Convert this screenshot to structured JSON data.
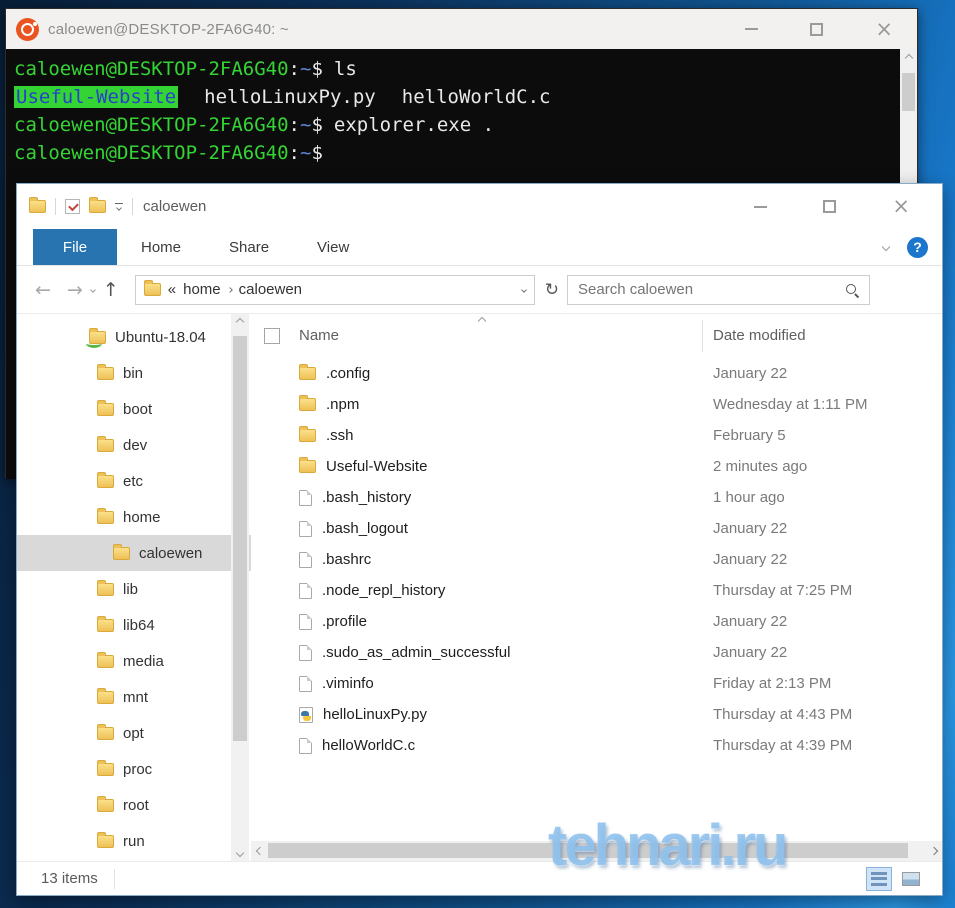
{
  "desktop": {
    "watermark": "tehnari.ru"
  },
  "terminal": {
    "title": "caloewen@DESKTOP-2FA6G40: ~",
    "user_host": "caloewen@DESKTOP-2FA6G40",
    "separator": ":",
    "path": "~",
    "prompt_symbol": "$",
    "command_ls": "ls",
    "ls_output": {
      "highlighted_dir": "Useful-Website",
      "file1": "helloLinuxPy.py",
      "file2": "helloWorldC.c"
    },
    "command_explorer": "explorer.exe .",
    "colors": {
      "prompt_green": "#35d435",
      "path_blue": "#5f87d7",
      "dir_text_blue": "#2742c9",
      "background": "#0c0c0c"
    }
  },
  "explorer": {
    "title": "caloewen",
    "tabs": {
      "file": "File",
      "home": "Home",
      "share": "Share",
      "view": "View"
    },
    "address": {
      "prefix": "«",
      "crumb1": "home",
      "crumb2": "caloewen"
    },
    "search": {
      "placeholder": "Search caloewen"
    },
    "columns": {
      "name": "Name",
      "date_modified": "Date modified"
    },
    "tree": [
      {
        "label": "Ubuntu-18.04",
        "level": 0,
        "icon": "ubuntu-folder",
        "selected": false
      },
      {
        "label": "bin",
        "level": 1,
        "icon": "folder",
        "selected": false
      },
      {
        "label": "boot",
        "level": 1,
        "icon": "folder",
        "selected": false
      },
      {
        "label": "dev",
        "level": 1,
        "icon": "folder",
        "selected": false
      },
      {
        "label": "etc",
        "level": 1,
        "icon": "folder",
        "selected": false
      },
      {
        "label": "home",
        "level": 1,
        "icon": "folder",
        "selected": false
      },
      {
        "label": "caloewen",
        "level": 2,
        "icon": "folder",
        "selected": true
      },
      {
        "label": "lib",
        "level": 1,
        "icon": "folder",
        "selected": false
      },
      {
        "label": "lib64",
        "level": 1,
        "icon": "folder",
        "selected": false
      },
      {
        "label": "media",
        "level": 1,
        "icon": "folder",
        "selected": false
      },
      {
        "label": "mnt",
        "level": 1,
        "icon": "folder",
        "selected": false
      },
      {
        "label": "opt",
        "level": 1,
        "icon": "folder",
        "selected": false
      },
      {
        "label": "proc",
        "level": 1,
        "icon": "folder",
        "selected": false
      },
      {
        "label": "root",
        "level": 1,
        "icon": "folder",
        "selected": false
      },
      {
        "label": "run",
        "level": 1,
        "icon": "folder",
        "selected": false
      }
    ],
    "files": [
      {
        "name": ".config",
        "icon": "folder",
        "date": "January 22"
      },
      {
        "name": ".npm",
        "icon": "folder",
        "date": "Wednesday at 1:11 PM"
      },
      {
        "name": ".ssh",
        "icon": "folder",
        "date": "February 5"
      },
      {
        "name": "Useful-Website",
        "icon": "folder",
        "date": "2 minutes ago"
      },
      {
        "name": ".bash_history",
        "icon": "file",
        "date": "1 hour ago"
      },
      {
        "name": ".bash_logout",
        "icon": "file",
        "date": "January 22"
      },
      {
        "name": ".bashrc",
        "icon": "file",
        "date": "January 22"
      },
      {
        "name": ".node_repl_history",
        "icon": "file",
        "date": "Thursday at 7:25 PM"
      },
      {
        "name": ".profile",
        "icon": "file",
        "date": "January 22"
      },
      {
        "name": ".sudo_as_admin_successful",
        "icon": "file",
        "date": "January 22"
      },
      {
        "name": ".viminfo",
        "icon": "file",
        "date": "Friday at 2:13 PM"
      },
      {
        "name": "helloLinuxPy.py",
        "icon": "python",
        "date": "Thursday at 4:43 PM"
      },
      {
        "name": "helloWorldC.c",
        "icon": "file",
        "date": "Thursday at 4:39 PM"
      }
    ],
    "status_bar": {
      "items_count": "13 items"
    },
    "colors": {
      "file_tab_blue": "#2874b0",
      "selection_gray": "#d9d9d9",
      "help_blue": "#1c76cc",
      "folder_yellow": "#eec157"
    }
  }
}
